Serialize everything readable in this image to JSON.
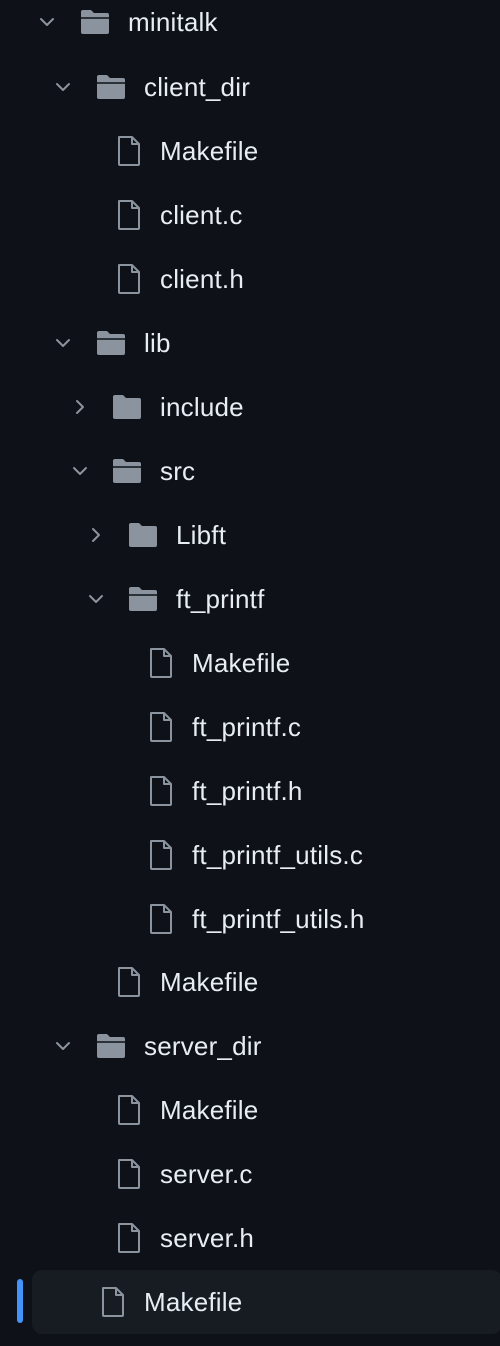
{
  "colors": {
    "background": "#0e1117",
    "text": "#e6edf3",
    "icon": "#8b949e",
    "folder_icon": "#8b949e",
    "selected_row_bg": "#171b22",
    "active_indicator": "#4493f8"
  },
  "tree": {
    "root": {
      "label": "minitalk",
      "icon": "folder-open-icon",
      "expanded": true
    },
    "client_dir": {
      "label": "client_dir",
      "icon": "folder-open-icon",
      "expanded": true,
      "files": [
        "Makefile",
        "client.c",
        "client.h"
      ]
    },
    "lib": {
      "label": "lib",
      "icon": "folder-open-icon",
      "expanded": true,
      "include": {
        "label": "include",
        "icon": "folder-icon",
        "expanded": false
      },
      "src": {
        "label": "src",
        "icon": "folder-open-icon",
        "expanded": true,
        "libft": {
          "label": "Libft",
          "icon": "folder-icon",
          "expanded": false
        },
        "ft_printf": {
          "label": "ft_printf",
          "icon": "folder-open-icon",
          "expanded": true,
          "files": [
            "Makefile",
            "ft_printf.c",
            "ft_printf.h",
            "ft_printf_utils.c",
            "ft_printf_utils.h"
          ]
        }
      },
      "makefile": "Makefile"
    },
    "server_dir": {
      "label": "server_dir",
      "icon": "folder-open-icon",
      "expanded": true,
      "files": [
        "Makefile",
        "server.c",
        "server.h"
      ]
    },
    "root_makefile": {
      "label": "Makefile",
      "selected": true
    }
  }
}
